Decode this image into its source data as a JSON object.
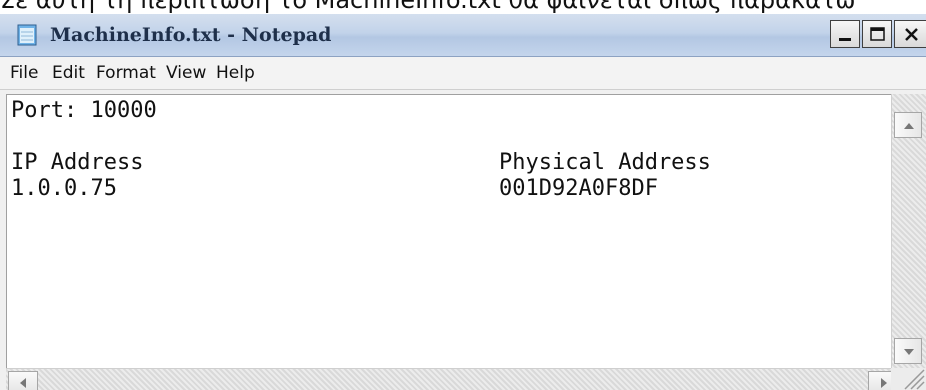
{
  "caption": "Σε αυτή τη περίπτωση το MachineInfo.txt θα φαίνεται όπως παρακάτω",
  "window": {
    "title": "MachineInfo.txt - Notepad",
    "controls": {
      "minimize": "minimize",
      "maximize": "maximize",
      "close": "close"
    }
  },
  "menu": [
    {
      "label": "File"
    },
    {
      "label": "Edit"
    },
    {
      "label": "Format"
    },
    {
      "label": "View"
    },
    {
      "label": "Help"
    }
  ],
  "document": {
    "port_line": "Port: 10000",
    "col1_header": "IP Address",
    "col2_header": "Physical Address",
    "ip_value": "1.0.0.75",
    "mac_value": "001D92A0F8DF"
  },
  "icons": {
    "app": "notepad-icon",
    "scroll_up": "arrow-up-icon",
    "scroll_down": "arrow-down-icon",
    "scroll_left": "arrow-left-icon",
    "scroll_right": "arrow-right-icon",
    "grip": "resize-grip-icon"
  }
}
